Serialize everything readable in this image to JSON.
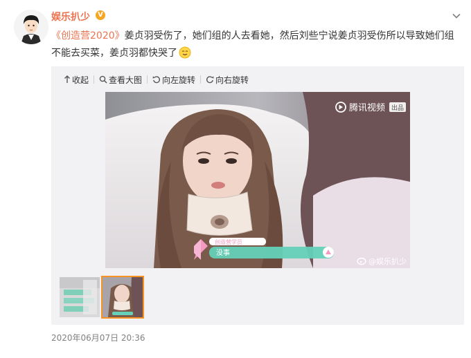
{
  "user": {
    "name": "娱乐扒少",
    "verified_badge": "V"
  },
  "post": {
    "hashtag": "《创造营2020》",
    "text": "姜贞羽受伤了，她们组的人去看她，然后刘些宁说姜贞羽受伤所以导致她们组不能去买菜，姜贞羽都快哭了",
    "emoji": "smiling-face-emoji"
  },
  "toolbar": {
    "collapse_label": "收起",
    "view_large_label": "查看大图",
    "rotate_left_label": "向左旋转",
    "rotate_right_label": "向右旋转"
  },
  "video": {
    "platform_logo_text": "腾讯视频",
    "platform_logo_badge": "出品",
    "subtitle_tag": "创造营学员",
    "subtitle_text": "没事",
    "watermark": "@娱乐扒少"
  },
  "thumbnails": {
    "count": 2,
    "selected_index": 1
  },
  "timestamp": "2020年06月07日 20:36",
  "colors": {
    "username": "#eb7350",
    "link": "#eb7350",
    "selected_thumb_outline": "#f79223",
    "media_bg": "#f2f2f5",
    "subtitle_bar": "#65d1b8",
    "subtitle_accent": "#f49ac1"
  },
  "icons": {
    "more": "chevron-down-icon",
    "collapse": "arrow-up-icon",
    "view_large": "magnifier-icon",
    "rotate_left": "rotate-left-icon",
    "rotate_right": "rotate-right-icon"
  }
}
